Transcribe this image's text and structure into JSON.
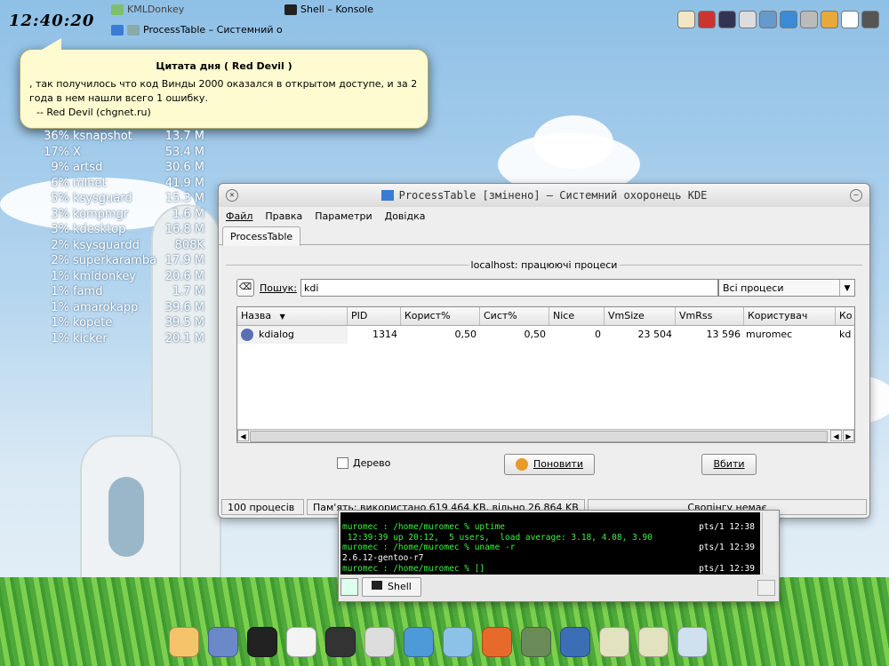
{
  "clock": "12:40:20",
  "topbar": {
    "task1": "KMLDonkey",
    "task2": "ProcessTable – Системний о",
    "task3": "Shell – Konsole"
  },
  "quote": {
    "title": "Цитата дня ( Red Devil )",
    "line1": ", так получилось что код Винды 2000 оказался в открытом доступе, и за 2",
    "line2": "года в нем нашли всего 1 ошибку.",
    "line3": "-- Red Devil (chgnet.ru)"
  },
  "desktop_procs": [
    {
      "pct": "36%",
      "name": "ksnapshot",
      "mem": "13.7 M"
    },
    {
      "pct": "17%",
      "name": "X",
      "mem": "53.4 M"
    },
    {
      "pct": "9%",
      "name": "artsd",
      "mem": "30.6 M"
    },
    {
      "pct": "6%",
      "name": "mlnet",
      "mem": "41.9 M"
    },
    {
      "pct": "5%",
      "name": "ksysguard",
      "mem": "15.3 M"
    },
    {
      "pct": "3%",
      "name": "kompmgr",
      "mem": "1.6 M"
    },
    {
      "pct": "3%",
      "name": "kdesktop",
      "mem": "16.8 M"
    },
    {
      "pct": "2%",
      "name": "ksysguardd",
      "mem": "808K"
    },
    {
      "pct": "2%",
      "name": "superkaramba",
      "mem": "17.9 M"
    },
    {
      "pct": "1%",
      "name": "kmldonkey",
      "mem": "20.6 M"
    },
    {
      "pct": "1%",
      "name": "famd",
      "mem": "1.7 M"
    },
    {
      "pct": "1%",
      "name": "amarokapp",
      "mem": "39.6 M"
    },
    {
      "pct": "1%",
      "name": "kopete",
      "mem": "39.5 M"
    },
    {
      "pct": "1%",
      "name": "kicker",
      "mem": "20.1 M"
    }
  ],
  "window": {
    "title": "ProcessTable [змінено] – Системний охоронець KDE",
    "menu": [
      "Файл",
      "Правка",
      "Параметри",
      "Довідка"
    ],
    "tab": "ProcessTable",
    "group": "localhost: працюючі процеси",
    "search_label": "Пошук:",
    "search_value": "kdi",
    "filter_selected": "Всі процеси",
    "columns": [
      "Назва",
      "PID",
      "Корист%",
      "Сист%",
      "Nice",
      "VmSize",
      "VmRss",
      "Користувач",
      "Ко"
    ],
    "rows": [
      {
        "name": "kdialog",
        "pid": "1314",
        "user_pct": "0,50",
        "sys_pct": "0,50",
        "nice": "0",
        "vmsize": "23 504",
        "vmrss": "13 596",
        "user": "muromec",
        "cmd": "kd"
      }
    ],
    "tree_label": "Дерево",
    "refresh_label": "Поновити",
    "kill_label": "Вбити",
    "status": {
      "procs": "100 процесів",
      "memory": "Пам'ять: використано 619 464 KB, вільно 26 864 KB",
      "swap": "Свопінгу немає"
    }
  },
  "konsole": {
    "lines": [
      {
        "text": "muromec : /home/muromec % uptime",
        "right": "pts/1 12:38",
        "green": true
      },
      {
        "text": " 12:39:39 up 20:12,  5 users,  load average: 3.18, 4.08, 3.90",
        "right": "",
        "green": true
      },
      {
        "text": "muromec : /home/muromec % uname -r",
        "right": "pts/1 12:39",
        "green": true
      },
      {
        "text": "2.6.12-gentoo-r7",
        "right": "",
        "green": false
      },
      {
        "text": "muromec : /home/muromec % []",
        "right": "pts/1 12:39",
        "green": true
      }
    ],
    "tab_label": "Shell"
  },
  "colors": {
    "accent": "#3a7bd5",
    "terminal_green": "#3ff03f"
  }
}
